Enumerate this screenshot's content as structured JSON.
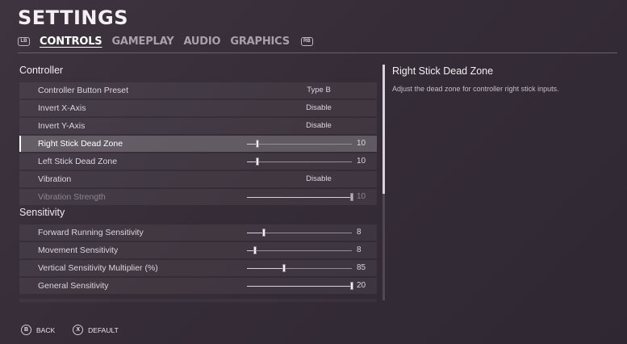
{
  "header": {
    "title": "SETTINGS",
    "left_bumper": "LB",
    "right_bumper": "RB",
    "tabs": [
      {
        "label": "CONTROLS",
        "active": true
      },
      {
        "label": "GAMEPLAY",
        "active": false
      },
      {
        "label": "AUDIO",
        "active": false
      },
      {
        "label": "GRAPHICS",
        "active": false
      }
    ]
  },
  "sections": [
    {
      "heading": "Controller",
      "rows": [
        {
          "label": "Controller Button Preset",
          "kind": "option",
          "value": "Type B"
        },
        {
          "label": "Invert X-Axis",
          "kind": "option",
          "value": "Disable"
        },
        {
          "label": "Invert Y-Axis",
          "kind": "option",
          "value": "Disable"
        },
        {
          "label": "Right Stick Dead Zone",
          "kind": "slider",
          "value": "10",
          "fraction": 0.1,
          "selected": true
        },
        {
          "label": "Left Stick Dead Zone",
          "kind": "slider",
          "value": "10",
          "fraction": 0.1
        },
        {
          "label": "Vibration",
          "kind": "option",
          "value": "Disable"
        },
        {
          "label": "Vibration Strength",
          "kind": "slider",
          "value": "10",
          "fraction": 1.0,
          "disabled": true
        }
      ]
    },
    {
      "heading": "Sensitivity",
      "rows": [
        {
          "label": "Forward Running Sensitivity",
          "kind": "slider",
          "value": "8",
          "fraction": 0.16
        },
        {
          "label": "Movement Sensitivity",
          "kind": "slider",
          "value": "8",
          "fraction": 0.08
        },
        {
          "label": "Vertical Sensitivity Multiplier (%)",
          "kind": "slider",
          "value": "85",
          "fraction": 0.35
        },
        {
          "label": "General Sensitivity",
          "kind": "slider",
          "value": "20",
          "fraction": 1.0
        }
      ]
    }
  ],
  "detail": {
    "title": "Right Stick Dead Zone",
    "description": "Adjust the dead zone for controller right stick inputs."
  },
  "footer": {
    "back_glyph": "B",
    "back_label": "BACK",
    "default_glyph": "X",
    "default_label": "DEFAULT"
  }
}
